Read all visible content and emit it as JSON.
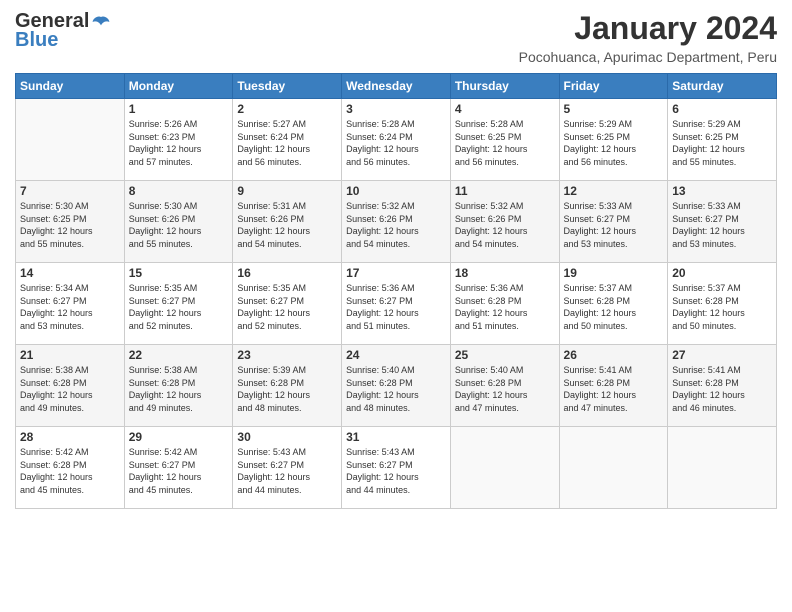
{
  "logo": {
    "line1": "General",
    "line2": "Blue"
  },
  "header": {
    "month": "January 2024",
    "location": "Pocohuanca, Apurimac Department, Peru"
  },
  "days_of_week": [
    "Sunday",
    "Monday",
    "Tuesday",
    "Wednesday",
    "Thursday",
    "Friday",
    "Saturday"
  ],
  "weeks": [
    [
      {
        "num": "",
        "info": ""
      },
      {
        "num": "1",
        "info": "Sunrise: 5:26 AM\nSunset: 6:23 PM\nDaylight: 12 hours\nand 57 minutes."
      },
      {
        "num": "2",
        "info": "Sunrise: 5:27 AM\nSunset: 6:24 PM\nDaylight: 12 hours\nand 56 minutes."
      },
      {
        "num": "3",
        "info": "Sunrise: 5:28 AM\nSunset: 6:24 PM\nDaylight: 12 hours\nand 56 minutes."
      },
      {
        "num": "4",
        "info": "Sunrise: 5:28 AM\nSunset: 6:25 PM\nDaylight: 12 hours\nand 56 minutes."
      },
      {
        "num": "5",
        "info": "Sunrise: 5:29 AM\nSunset: 6:25 PM\nDaylight: 12 hours\nand 56 minutes."
      },
      {
        "num": "6",
        "info": "Sunrise: 5:29 AM\nSunset: 6:25 PM\nDaylight: 12 hours\nand 55 minutes."
      }
    ],
    [
      {
        "num": "7",
        "info": "Sunrise: 5:30 AM\nSunset: 6:25 PM\nDaylight: 12 hours\nand 55 minutes."
      },
      {
        "num": "8",
        "info": "Sunrise: 5:30 AM\nSunset: 6:26 PM\nDaylight: 12 hours\nand 55 minutes."
      },
      {
        "num": "9",
        "info": "Sunrise: 5:31 AM\nSunset: 6:26 PM\nDaylight: 12 hours\nand 54 minutes."
      },
      {
        "num": "10",
        "info": "Sunrise: 5:32 AM\nSunset: 6:26 PM\nDaylight: 12 hours\nand 54 minutes."
      },
      {
        "num": "11",
        "info": "Sunrise: 5:32 AM\nSunset: 6:26 PM\nDaylight: 12 hours\nand 54 minutes."
      },
      {
        "num": "12",
        "info": "Sunrise: 5:33 AM\nSunset: 6:27 PM\nDaylight: 12 hours\nand 53 minutes."
      },
      {
        "num": "13",
        "info": "Sunrise: 5:33 AM\nSunset: 6:27 PM\nDaylight: 12 hours\nand 53 minutes."
      }
    ],
    [
      {
        "num": "14",
        "info": "Sunrise: 5:34 AM\nSunset: 6:27 PM\nDaylight: 12 hours\nand 53 minutes."
      },
      {
        "num": "15",
        "info": "Sunrise: 5:35 AM\nSunset: 6:27 PM\nDaylight: 12 hours\nand 52 minutes."
      },
      {
        "num": "16",
        "info": "Sunrise: 5:35 AM\nSunset: 6:27 PM\nDaylight: 12 hours\nand 52 minutes."
      },
      {
        "num": "17",
        "info": "Sunrise: 5:36 AM\nSunset: 6:27 PM\nDaylight: 12 hours\nand 51 minutes."
      },
      {
        "num": "18",
        "info": "Sunrise: 5:36 AM\nSunset: 6:28 PM\nDaylight: 12 hours\nand 51 minutes."
      },
      {
        "num": "19",
        "info": "Sunrise: 5:37 AM\nSunset: 6:28 PM\nDaylight: 12 hours\nand 50 minutes."
      },
      {
        "num": "20",
        "info": "Sunrise: 5:37 AM\nSunset: 6:28 PM\nDaylight: 12 hours\nand 50 minutes."
      }
    ],
    [
      {
        "num": "21",
        "info": "Sunrise: 5:38 AM\nSunset: 6:28 PM\nDaylight: 12 hours\nand 49 minutes."
      },
      {
        "num": "22",
        "info": "Sunrise: 5:38 AM\nSunset: 6:28 PM\nDaylight: 12 hours\nand 49 minutes."
      },
      {
        "num": "23",
        "info": "Sunrise: 5:39 AM\nSunset: 6:28 PM\nDaylight: 12 hours\nand 48 minutes."
      },
      {
        "num": "24",
        "info": "Sunrise: 5:40 AM\nSunset: 6:28 PM\nDaylight: 12 hours\nand 48 minutes."
      },
      {
        "num": "25",
        "info": "Sunrise: 5:40 AM\nSunset: 6:28 PM\nDaylight: 12 hours\nand 47 minutes."
      },
      {
        "num": "26",
        "info": "Sunrise: 5:41 AM\nSunset: 6:28 PM\nDaylight: 12 hours\nand 47 minutes."
      },
      {
        "num": "27",
        "info": "Sunrise: 5:41 AM\nSunset: 6:28 PM\nDaylight: 12 hours\nand 46 minutes."
      }
    ],
    [
      {
        "num": "28",
        "info": "Sunrise: 5:42 AM\nSunset: 6:28 PM\nDaylight: 12 hours\nand 45 minutes."
      },
      {
        "num": "29",
        "info": "Sunrise: 5:42 AM\nSunset: 6:27 PM\nDaylight: 12 hours\nand 45 minutes."
      },
      {
        "num": "30",
        "info": "Sunrise: 5:43 AM\nSunset: 6:27 PM\nDaylight: 12 hours\nand 44 minutes."
      },
      {
        "num": "31",
        "info": "Sunrise: 5:43 AM\nSunset: 6:27 PM\nDaylight: 12 hours\nand 44 minutes."
      },
      {
        "num": "",
        "info": ""
      },
      {
        "num": "",
        "info": ""
      },
      {
        "num": "",
        "info": ""
      }
    ]
  ]
}
